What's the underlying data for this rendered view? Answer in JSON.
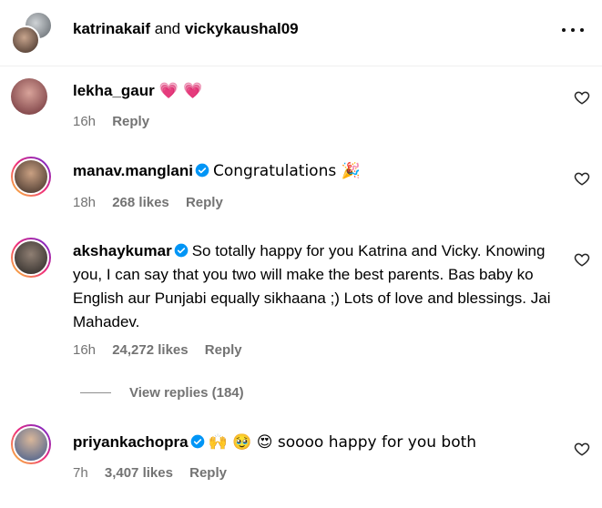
{
  "header": {
    "user1": "katrinakaif",
    "conj": " and ",
    "user2": "vickykaushal09"
  },
  "comments": [
    {
      "username": "lekha_gaur",
      "text": "💗 💗",
      "time": "16h",
      "likes": "",
      "reply": "Reply",
      "verified": false
    },
    {
      "username": "manav.manglani",
      "text": "Congratulations 🎉",
      "time": "18h",
      "likes": "268 likes",
      "reply": "Reply",
      "verified": true
    },
    {
      "username": "akshaykumar",
      "text": "So totally happy for you Katrina and Vicky. Knowing you, I can say that you two will make the best parents. Bas baby ko English aur Punjabi equally sikhaana ;) Lots of love and blessings. Jai Mahadev.",
      "time": "16h",
      "likes": "24,272 likes",
      "reply": "Reply",
      "verified": true
    },
    {
      "username": "priyankachopra",
      "text": "🙌 🥹 😍 soooo happy for you both",
      "time": "7h",
      "likes": "3,407 likes",
      "reply": "Reply",
      "verified": true
    }
  ],
  "view_replies": "View replies (184)",
  "colors": {
    "verified": "#0095f6",
    "meta": "#737373",
    "ring_gradient": [
      "#f9ce34",
      "#ee2a7b",
      "#6228d7"
    ]
  }
}
